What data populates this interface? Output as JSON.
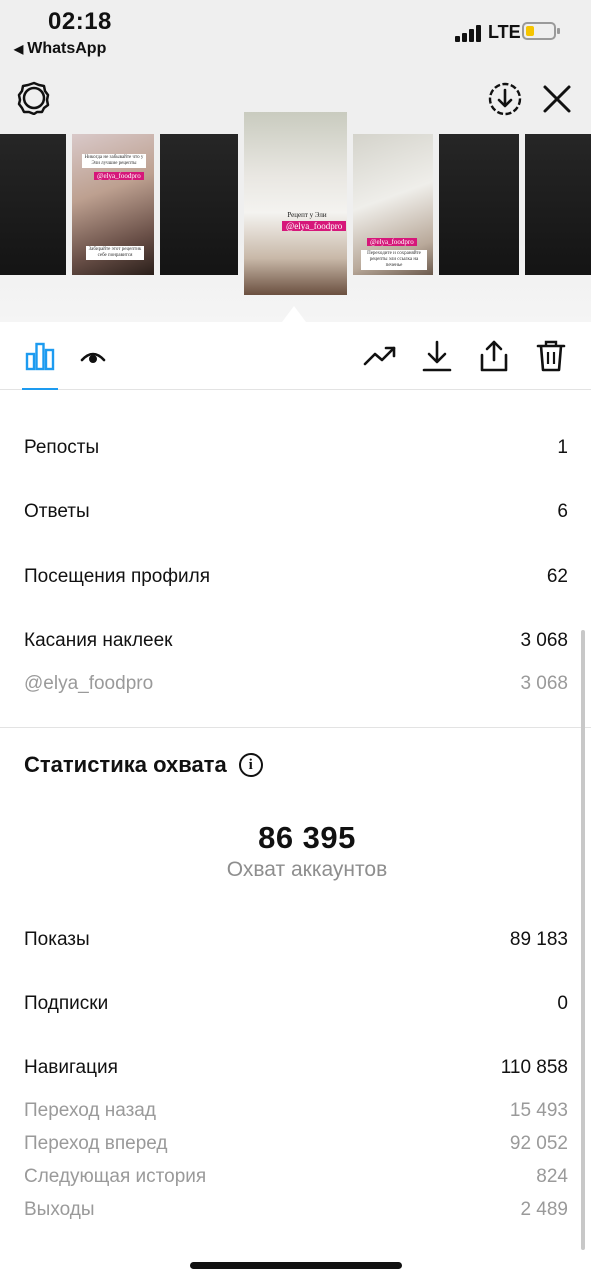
{
  "status_bar": {
    "time": "02:18",
    "back_app": "WhatsApp",
    "back_arrow": "◀",
    "network": "LTE",
    "signal_icon": "signal-bars-icon",
    "battery_icon": "battery-low-icon"
  },
  "header": {
    "settings_icon": "gear-icon",
    "save_icon": "download-circle-icon",
    "close_icon": "close-icon"
  },
  "thumbnails": {
    "left_note": "Никогда не забывайте что у Эли лучшие рецепты",
    "left_sticker": "@elya_foodpro",
    "left_bottom_note": "Забирайте этот рецептик себе понравится",
    "center_caption": "Рецепт у Эли",
    "center_sticker": "@elya_foodpro",
    "right_sticker": "@elya_foodpro",
    "right_note": "Переходите и сохраняйте рецепты эли ссылка на печенье"
  },
  "tabs": {
    "active": "insights",
    "items": [
      "insights-bar-chart-icon",
      "viewers-eye-icon"
    ],
    "actions": [
      "promote-trend-icon",
      "download-icon",
      "share-icon",
      "trash-icon"
    ]
  },
  "interactions": [
    {
      "label": "Репосты",
      "value": "1"
    },
    {
      "label": "Ответы",
      "value": "6"
    },
    {
      "label": "Посещения профиля",
      "value": "62"
    },
    {
      "label": "Касания наклеек",
      "value": "3 068"
    }
  ],
  "sticker_breakdown": {
    "label": "@elya_foodpro",
    "value": "3 068"
  },
  "reach": {
    "title": "Статистика охвата",
    "info_symbol": "i",
    "accounts_reached": "86 395",
    "accounts_reached_label": "Охват аккаунтов"
  },
  "reach_rows": [
    {
      "label": "Показы",
      "value": "89 183"
    },
    {
      "label": "Подписки",
      "value": "0"
    },
    {
      "label": "Навигация",
      "value": "110 858"
    }
  ],
  "navigation_breakdown": [
    {
      "label": "Переход назад",
      "value": "15 493"
    },
    {
      "label": "Переход вперед",
      "value": "92 052"
    },
    {
      "label": "Следующая история",
      "value": "824"
    },
    {
      "label": "Выходы",
      "value": "2 489"
    }
  ],
  "colors": {
    "accent": "#1d9bf0",
    "sticker": "#d6177a",
    "muted": "#9a9a9a"
  }
}
